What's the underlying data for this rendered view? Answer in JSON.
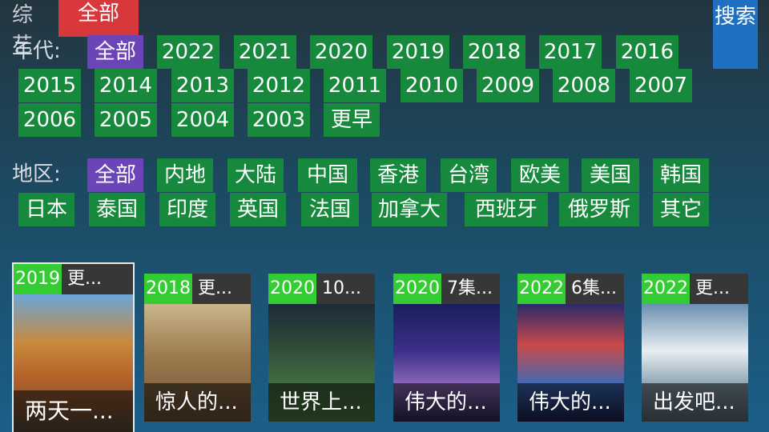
{
  "category": {
    "label": "综艺",
    "chip": "全部"
  },
  "search_label": "搜索",
  "year": {
    "label": "年代:",
    "options": [
      "全部",
      "2022",
      "2021",
      "2020",
      "2019",
      "2018",
      "2017",
      "2016",
      "2015",
      "2014",
      "2013",
      "2012",
      "2011",
      "2010",
      "2009",
      "2008",
      "2007",
      "2006",
      "2005",
      "2004",
      "2003",
      "更早"
    ],
    "selected": "全部"
  },
  "region": {
    "label": "地区:",
    "options": [
      "全部",
      "内地",
      "大陆",
      "中国",
      "香港",
      "台湾",
      "欧美",
      "美国",
      "韩国",
      "日本",
      "泰国",
      "印度",
      "英国",
      "法国",
      "加拿大",
      "西班牙",
      "俄罗斯",
      "其它"
    ],
    "selected": "全部"
  },
  "cards": [
    {
      "year": "2019",
      "status": "更...",
      "title": "两天一..."
    },
    {
      "year": "2018",
      "status": "更...",
      "title": "惊人的..."
    },
    {
      "year": "2020",
      "status": "10...",
      "title": "世界上..."
    },
    {
      "year": "2020",
      "status": "7集...",
      "title": "伟大的..."
    },
    {
      "year": "2022",
      "status": "6集...",
      "title": "伟大的..."
    },
    {
      "year": "2022",
      "status": "更...",
      "title": "出发吧..."
    }
  ],
  "colors": {
    "chip": "#16893d",
    "selected": "#6b45b8",
    "search": "#1f6fc3",
    "red": "#d8373b",
    "year_badge": "#33cc33"
  }
}
